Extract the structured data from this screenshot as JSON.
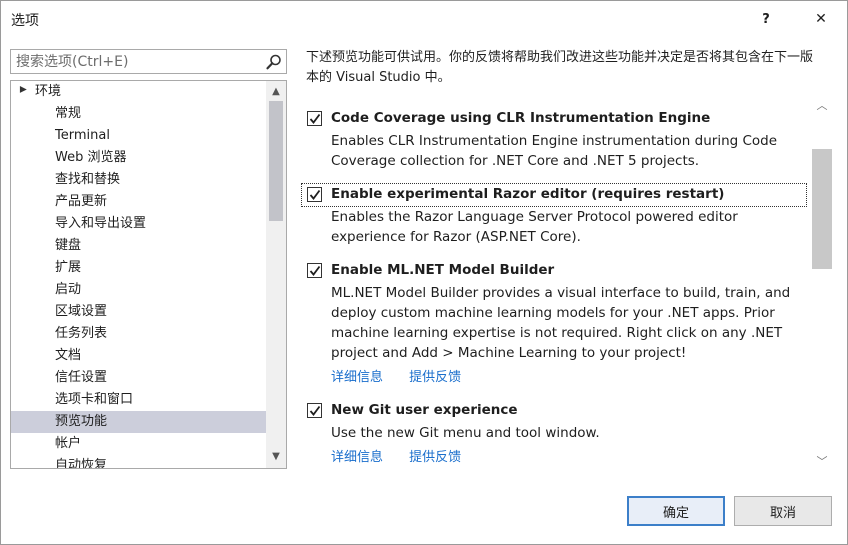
{
  "window": {
    "title": "选项",
    "help_label": "?",
    "close_label": "✕"
  },
  "search": {
    "placeholder": "搜索选项(Ctrl+E)"
  },
  "tree": {
    "items": [
      {
        "label": "环境",
        "expander": "▲"
      },
      {
        "label": "常规"
      },
      {
        "label": "Terminal"
      },
      {
        "label": "Web 浏览器"
      },
      {
        "label": "查找和替换"
      },
      {
        "label": "产品更新"
      },
      {
        "label": "导入和导出设置"
      },
      {
        "label": "键盘"
      },
      {
        "label": "扩展"
      },
      {
        "label": "启动"
      },
      {
        "label": "区域设置"
      },
      {
        "label": "任务列表"
      },
      {
        "label": "文档"
      },
      {
        "label": "信任设置"
      },
      {
        "label": "选项卡和窗口"
      },
      {
        "label": "预览功能"
      },
      {
        "label": "帐户"
      },
      {
        "label": "自动恢复"
      }
    ],
    "selected": "预览功能"
  },
  "intro": "下述预览功能可供试用。你的反馈将帮助我们改进这些功能并决定是否将其包含在下一版本的 Visual Studio 中。",
  "features": [
    {
      "title": "Code Coverage using CLR Instrumentation Engine",
      "checked": true,
      "description": "Enables CLR Instrumentation Engine instrumentation during Code Coverage collection for .NET Core and .NET 5 projects."
    },
    {
      "title": "Enable experimental Razor editor (requires restart)",
      "checked": true,
      "description": "Enables the Razor Language Server Protocol powered editor experience for Razor (ASP.NET Core)."
    },
    {
      "title": "Enable ML.NET Model Builder",
      "checked": true,
      "description": "ML.NET Model Builder provides a visual interface to build, train, and deploy custom machine learning models for your .NET apps. Prior machine learning expertise is not required. Right click on any .NET project and Add > Machine Learning to your project!",
      "link_details": "详细信息",
      "link_feedback": "提供反馈"
    },
    {
      "title": "New Git user experience",
      "checked": true,
      "description": "Use the new Git menu and tool window.",
      "link_details": "详细信息",
      "link_feedback": "提供反馈"
    }
  ],
  "buttons": {
    "ok": "确定",
    "cancel": "取消"
  },
  "colors": {
    "selection": "#cccedb",
    "link": "#1a6ecc",
    "primary_border": "#3c7fc9"
  }
}
